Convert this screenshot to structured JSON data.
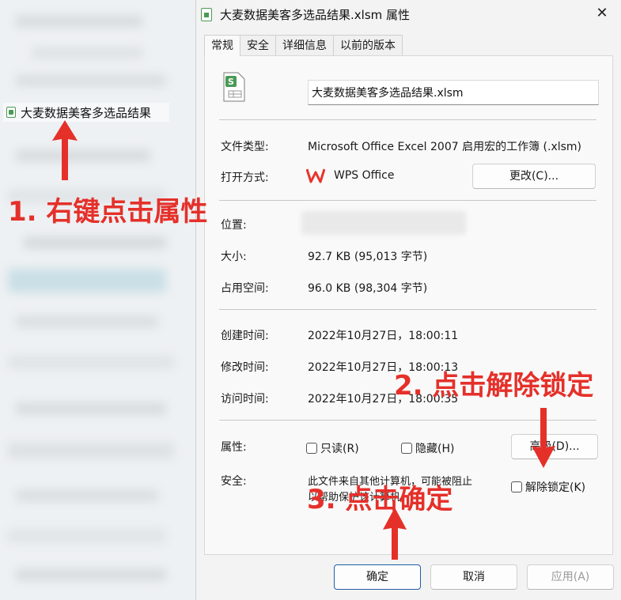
{
  "explorer": {
    "file_label": "大麦数据美客多选品结果"
  },
  "dialog": {
    "title": "大麦数据美客多选品结果.xlsm 属性",
    "close_glyph": "✕",
    "tabs": [
      {
        "label": "常规",
        "active": true
      },
      {
        "label": "安全"
      },
      {
        "label": "详细信息"
      },
      {
        "label": "以前的版本"
      }
    ],
    "filename": "大麦数据美客多选品结果.xlsm",
    "file_type": {
      "label": "文件类型:",
      "value": "Microsoft Office Excel 2007 启用宏的工作簿 (.xlsm)"
    },
    "open_with": {
      "label": "打开方式:",
      "app": "WPS Office",
      "change_button": "更改(C)..."
    },
    "location": {
      "label": "位置:"
    },
    "size": {
      "label": "大小:",
      "value": "92.7 KB (95,013 字节)"
    },
    "size_on_disk": {
      "label": "占用空间:",
      "value": "96.0 KB (98,304 字节)"
    },
    "created": {
      "label": "创建时间:",
      "value": "2022年10月27日，18:00:11"
    },
    "modified": {
      "label": "修改时间:",
      "value": "2022年10月27日，18:00:13"
    },
    "accessed": {
      "label": "访问时间:",
      "value": "2022年10月27日，18:00:35"
    },
    "attributes": {
      "label": "属性:",
      "readonly": "只读(R)",
      "hidden": "隐藏(H)",
      "advanced_button": "高级(D)..."
    },
    "security": {
      "label": "安全:",
      "message_line1": "此文件来自其他计算机，可能被阻止",
      "message_line2": "以帮助保护该计算机。",
      "unblock": "解除锁定(K)"
    },
    "buttons": {
      "ok": "确定",
      "cancel": "取消",
      "apply": "应用(A)"
    }
  },
  "annotations": {
    "step1": "1. 右键点击属性",
    "step2": "2. 点击解除锁定",
    "step3": "3. 点击确定",
    "color": "#e5302a"
  },
  "colors": {
    "excel_green": "#4a9a55",
    "wps_red": "#e8342c"
  }
}
